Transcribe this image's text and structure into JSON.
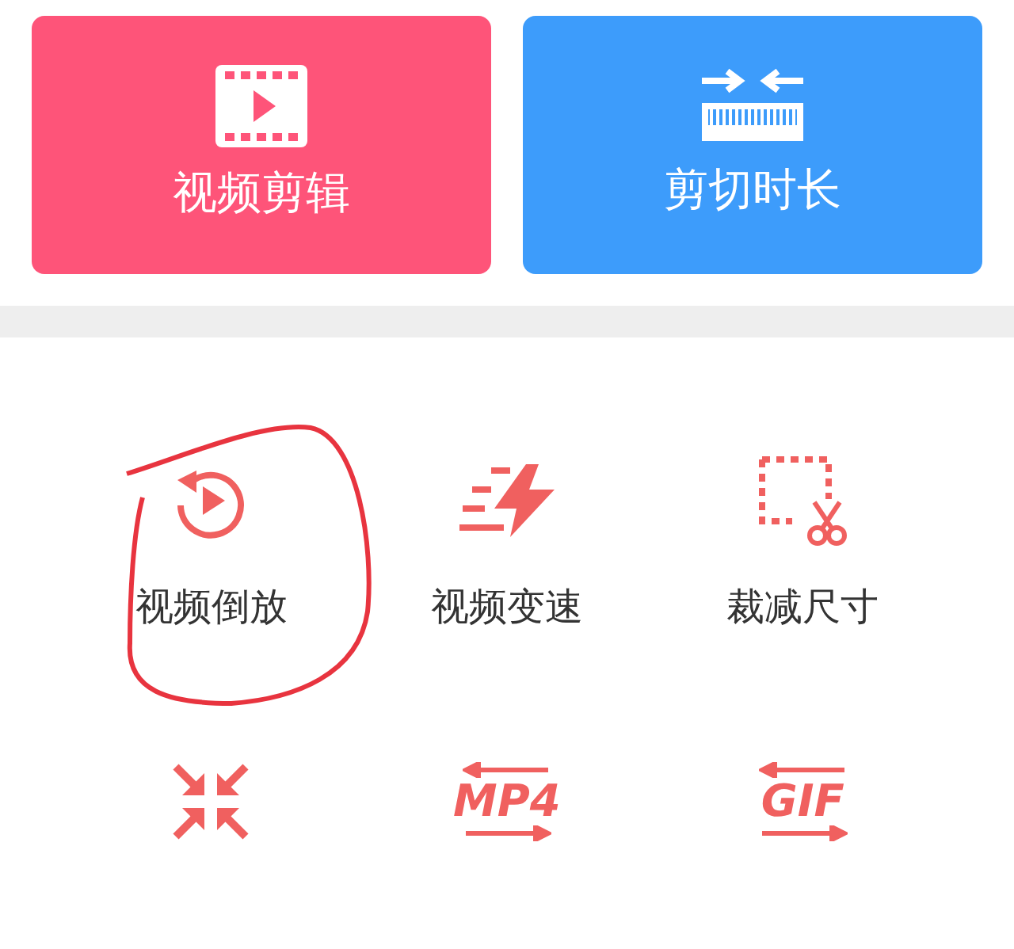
{
  "cards": [
    {
      "title": "视频剪辑",
      "kind": "film",
      "color": "#fe5479"
    },
    {
      "title": "剪切时长",
      "kind": "ruler",
      "color": "#3d9cfb"
    }
  ],
  "tools": [
    {
      "kind": "replay",
      "label": "视频倒放",
      "circled": true
    },
    {
      "kind": "speed",
      "label": "视频变速",
      "circled": false
    },
    {
      "kind": "crop",
      "label": "裁减尺寸",
      "circled": false
    },
    {
      "kind": "compress",
      "circled": false
    },
    {
      "kind": "convert",
      "icon_text": "MP4",
      "circled": false
    },
    {
      "kind": "convert",
      "icon_text": "GIF",
      "circled": false
    }
  ]
}
